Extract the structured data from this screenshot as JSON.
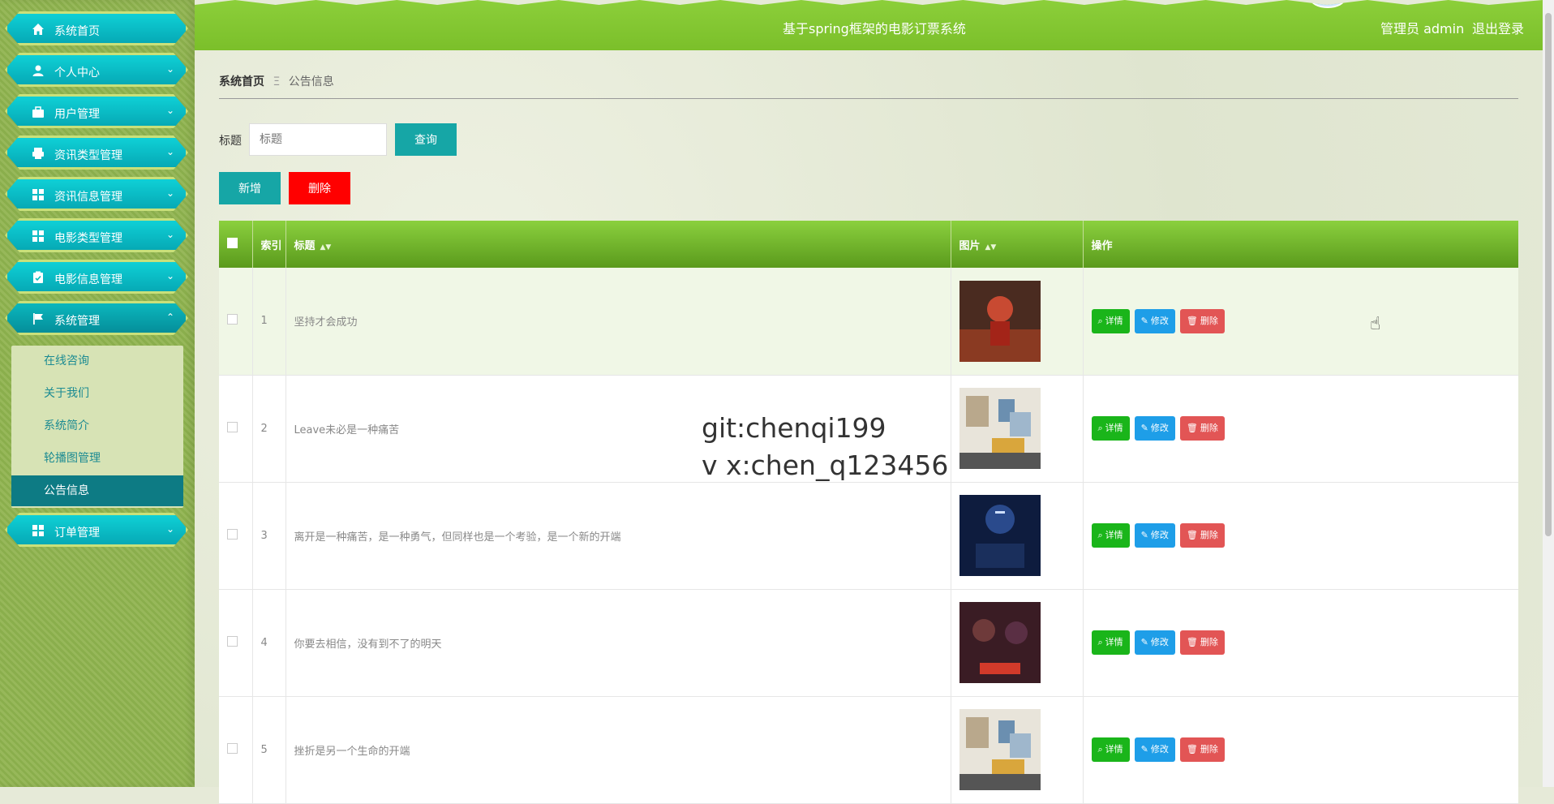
{
  "app": {
    "title": "基于spring框架的电影订票系统",
    "admin_label": "管理员 admin",
    "logout_label": "退出登录"
  },
  "sidebar": {
    "items": [
      {
        "label": "系统首页",
        "icon": "home-icon"
      },
      {
        "label": "个人中心",
        "icon": "user-icon",
        "arrow": "⌄"
      },
      {
        "label": "用户管理",
        "icon": "briefcase-icon",
        "arrow": "⌄"
      },
      {
        "label": "资讯类型管理",
        "icon": "print-icon",
        "arrow": "⌄"
      },
      {
        "label": "资讯信息管理",
        "icon": "grid-icon",
        "arrow": "⌄"
      },
      {
        "label": "电影类型管理",
        "icon": "grid-icon",
        "arrow": "⌄"
      },
      {
        "label": "电影信息管理",
        "icon": "clipboard-icon",
        "arrow": "⌄"
      },
      {
        "label": "系统管理",
        "icon": "flag-icon",
        "arrow": "⌃"
      },
      {
        "label": "订单管理",
        "icon": "grid-icon",
        "arrow": "⌄"
      }
    ],
    "submenu": [
      "在线咨询",
      "关于我们",
      "系统简介",
      "轮播图管理",
      "公告信息"
    ]
  },
  "breadcrumb": {
    "home": "系统首页",
    "separator": "Ξ",
    "current": "公告信息"
  },
  "search": {
    "label": "标题",
    "placeholder": "标题",
    "button": "查询"
  },
  "toolbar": {
    "add": "新增",
    "delete": "删除"
  },
  "table": {
    "headers": {
      "index": "索引",
      "title": "标题",
      "image": "图片",
      "actions": "操作"
    },
    "rows": [
      {
        "index": "1",
        "title": "坚持才会成功"
      },
      {
        "index": "2",
        "title": "Leave未必是一种痛苦"
      },
      {
        "index": "3",
        "title": "离开是一种痛苦，是一种勇气，但同样也是一个考验，是一个新的开端"
      },
      {
        "index": "4",
        "title": "你要去相信，没有到不了的明天"
      },
      {
        "index": "5",
        "title": "挫折是另一个生命的开端"
      }
    ],
    "action_labels": {
      "detail": "详情",
      "edit": "修改",
      "delete": "删除"
    }
  },
  "watermark": {
    "line1": "git:chenqi199",
    "line2": "v x:chen_q123456"
  },
  "colors": {
    "teal": "#16a6a6",
    "danger": "#ff0000",
    "header_green": "#7bbf2a"
  }
}
